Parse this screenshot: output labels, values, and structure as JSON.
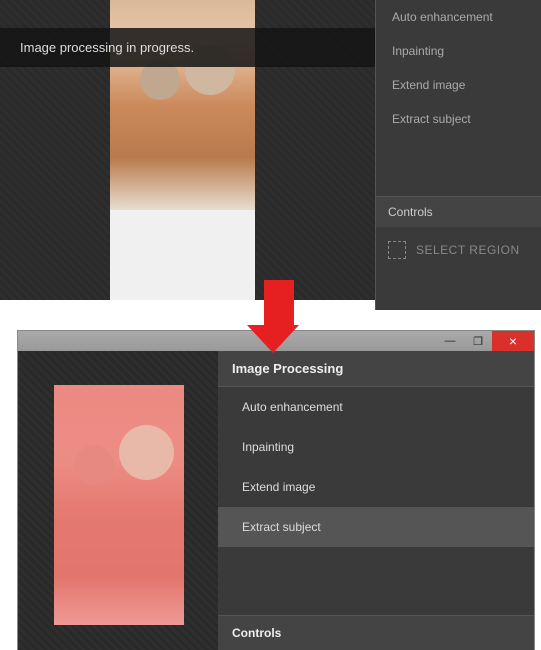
{
  "top": {
    "toast": "Image processing in progress.",
    "menu": {
      "items": [
        "Auto enhancement",
        "Inpainting",
        "Extend image",
        "Extract subject"
      ]
    },
    "controls_header": "Controls",
    "select_region": "SELECT REGION"
  },
  "bottom": {
    "window": {
      "min": "—",
      "max": "❐",
      "close": "×"
    },
    "panel_title": "Image Processing",
    "menu": {
      "items": [
        "Auto enhancement",
        "Inpainting",
        "Extend image",
        "Extract subject"
      ],
      "selected_index": 3
    },
    "controls_header": "Controls"
  }
}
